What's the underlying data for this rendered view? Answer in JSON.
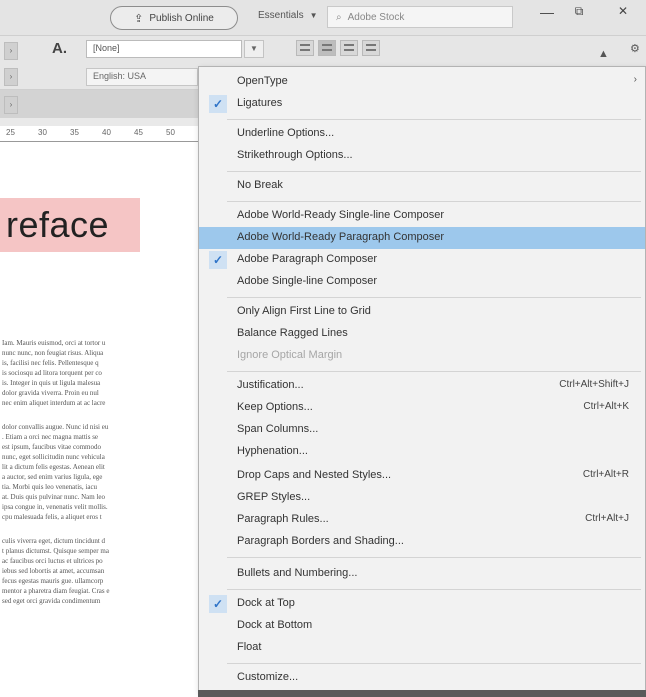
{
  "topbar": {
    "publish_label": "Publish Online",
    "workspace_label": "Essentials",
    "search_placeholder": "Adobe Stock"
  },
  "control_panel": {
    "font_style": "[None]",
    "language": "English: USA",
    "char_icon": "A."
  },
  "ruler": {
    "ticks": [
      "25",
      "30",
      "35",
      "40",
      "45",
      "50"
    ]
  },
  "document": {
    "headline": "reface",
    "body_lines": [
      "Iam. Mauris euismod, orci at tortor u",
      "nunc nunc, non feugiat risus. Aliqua",
      "is, facilisi nec felis. Pellentesque q",
      "is sociosqu ad litora torquent per co",
      "is. Integer in quis ut ligula malesua",
      "dolor gravida viverra. Proin eu nul",
      "nec enim aliquet interdum at ac lacre",
      "",
      "dolor convallis augue. Nunc id nisi eu",
      ". Etiam a orci nec magna mattis se",
      "est ipsum, faucibus vitae commodo",
      "nunc, eget sollicitudin nunc vehicula",
      "lit a dictum felis egestas. Aenean elit",
      "a auctor, sed enim varius ligula, ege",
      "tia. Morbi quis leo venenatis, iacu",
      "at. Duis quis pulvinar nunc. Nam leo",
      "ipsa congue in, venenatis velit mollis.",
      "cpu malesuada felis, a aliquet eros t",
      "",
      "culis viverra eget, dictum tincidunt d",
      "t planus dictumst. Quisque semper ma",
      "ac faucibus orci luctus et ultrices po",
      "iebus sed lobortis at amet, accumsan",
      "fecus egestas mauris gue. ullamcorp",
      "mentor a pharetra diam feugiat. Cras e",
      "sed eget orci gravida condimentum"
    ]
  },
  "menu": {
    "items": [
      {
        "label": "OpenType",
        "has_submenu": true,
        "checked": false
      },
      {
        "label": "Ligatures",
        "checked": true
      },
      {
        "label": "Underline Options...",
        "checked": false
      },
      {
        "label": "Strikethrough Options...",
        "checked": false
      },
      {
        "label": "No Break",
        "checked": false
      },
      {
        "label": "Adobe World-Ready Single-line Composer",
        "checked": false
      },
      {
        "label": "Adobe World-Ready Paragraph Composer",
        "checked": false,
        "highlighted": true
      },
      {
        "label": "Adobe Paragraph Composer",
        "checked": true
      },
      {
        "label": "Adobe Single-line Composer",
        "checked": false
      },
      {
        "label": "Only Align First Line to Grid",
        "checked": false
      },
      {
        "label": "Balance Ragged Lines",
        "checked": false
      },
      {
        "label": "Ignore Optical Margin",
        "checked": false,
        "disabled": true
      },
      {
        "label": "Justification...",
        "shortcut": "Ctrl+Alt+Shift+J"
      },
      {
        "label": "Keep Options...",
        "shortcut": "Ctrl+Alt+K"
      },
      {
        "label": "Span Columns..."
      },
      {
        "label": "Hyphenation..."
      },
      {
        "label": "Drop Caps and Nested Styles...",
        "shortcut": "Ctrl+Alt+R"
      },
      {
        "label": "GREP Styles..."
      },
      {
        "label": "Paragraph Rules...",
        "shortcut": "Ctrl+Alt+J"
      },
      {
        "label": "Paragraph Borders and Shading..."
      },
      {
        "label": "Bullets and Numbering..."
      },
      {
        "label": "Dock at Top",
        "checked": true
      },
      {
        "label": "Dock at Bottom"
      },
      {
        "label": "Float"
      },
      {
        "label": "Customize..."
      }
    ]
  },
  "colors": {
    "highlight": "#9dc8ec",
    "check": "#2f74c8",
    "headline_bg": "#f5c5c5"
  }
}
